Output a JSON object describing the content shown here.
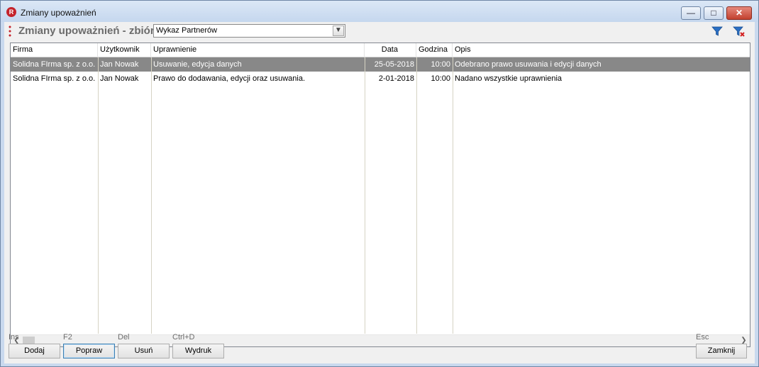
{
  "window": {
    "title": "Zmiany upoważnień",
    "app_icon_letter": "R",
    "controls": {
      "minimize": "—",
      "maximize": "□",
      "close": "✕"
    }
  },
  "toolbar": {
    "label": "Zmiany upoważnień - zbiór",
    "combo_value": "Wykaz Partnerów",
    "icons": [
      "filter-icon",
      "clear-filter-icon"
    ]
  },
  "grid": {
    "columns": [
      "Firma",
      "Użytkownik",
      "Uprawnienie",
      "Data",
      "Godzina",
      "Opis"
    ],
    "rows": [
      {
        "firma": "Solidna FIrma sp. z o.o.",
        "uzytkownik": "Jan Nowak",
        "uprawnienie": "Usuwanie, edycja danych",
        "data": "25-05-2018",
        "godzina": "10:00",
        "opis": "Odebrano prawo usuwania i edycji danych",
        "selected": true
      },
      {
        "firma": "Solidna FIrma sp. z o.o.",
        "uzytkownik": "Jan Nowak",
        "uprawnienie": "Prawo do dodawania, edycji oraz usuwania.",
        "data": "2-01-2018",
        "godzina": "10:00",
        "opis": "Nadano wszystkie uprawnienia",
        "selected": false
      }
    ]
  },
  "actions": {
    "add": {
      "hotkey": "Ins",
      "label": "Dodaj"
    },
    "edit": {
      "hotkey": "F2",
      "label": "Popraw"
    },
    "delete": {
      "hotkey": "Del",
      "label": "Usuń"
    },
    "print": {
      "hotkey": "Ctrl+D",
      "label": "Wydruk"
    },
    "close": {
      "hotkey": "Esc",
      "label": "Zamknij"
    }
  },
  "colors": {
    "selection": "#888888",
    "accent": "#c4232b",
    "filter_icon": "#2a6fc4"
  }
}
